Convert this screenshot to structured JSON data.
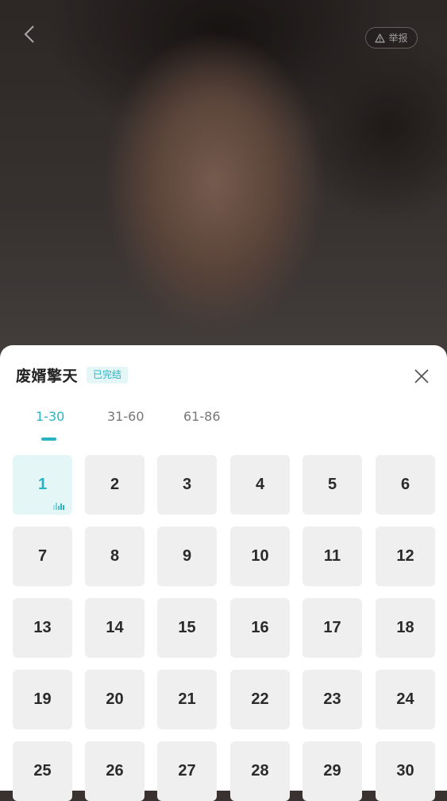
{
  "video": {
    "report_label": "举报"
  },
  "sheet": {
    "title": "废婿擎天",
    "status": "已完结",
    "tabs": [
      {
        "label": "1-30",
        "active": true
      },
      {
        "label": "31-60",
        "active": false
      },
      {
        "label": "61-86",
        "active": false
      }
    ],
    "episodes": [
      "1",
      "2",
      "3",
      "4",
      "5",
      "6",
      "7",
      "8",
      "9",
      "10",
      "11",
      "12",
      "13",
      "14",
      "15",
      "16",
      "17",
      "18",
      "19",
      "20",
      "21",
      "22",
      "23",
      "24",
      "25",
      "26",
      "27",
      "28",
      "29",
      "30"
    ],
    "current_episode": "1"
  },
  "colors": {
    "accent": "#2ab3c3",
    "accent_bg": "#e5f6f7",
    "tile_bg": "#efefef"
  },
  "icons": {
    "back": "chevron-left-icon",
    "report": "warning-icon",
    "close": "close-icon",
    "playing": "equalizer-icon"
  }
}
